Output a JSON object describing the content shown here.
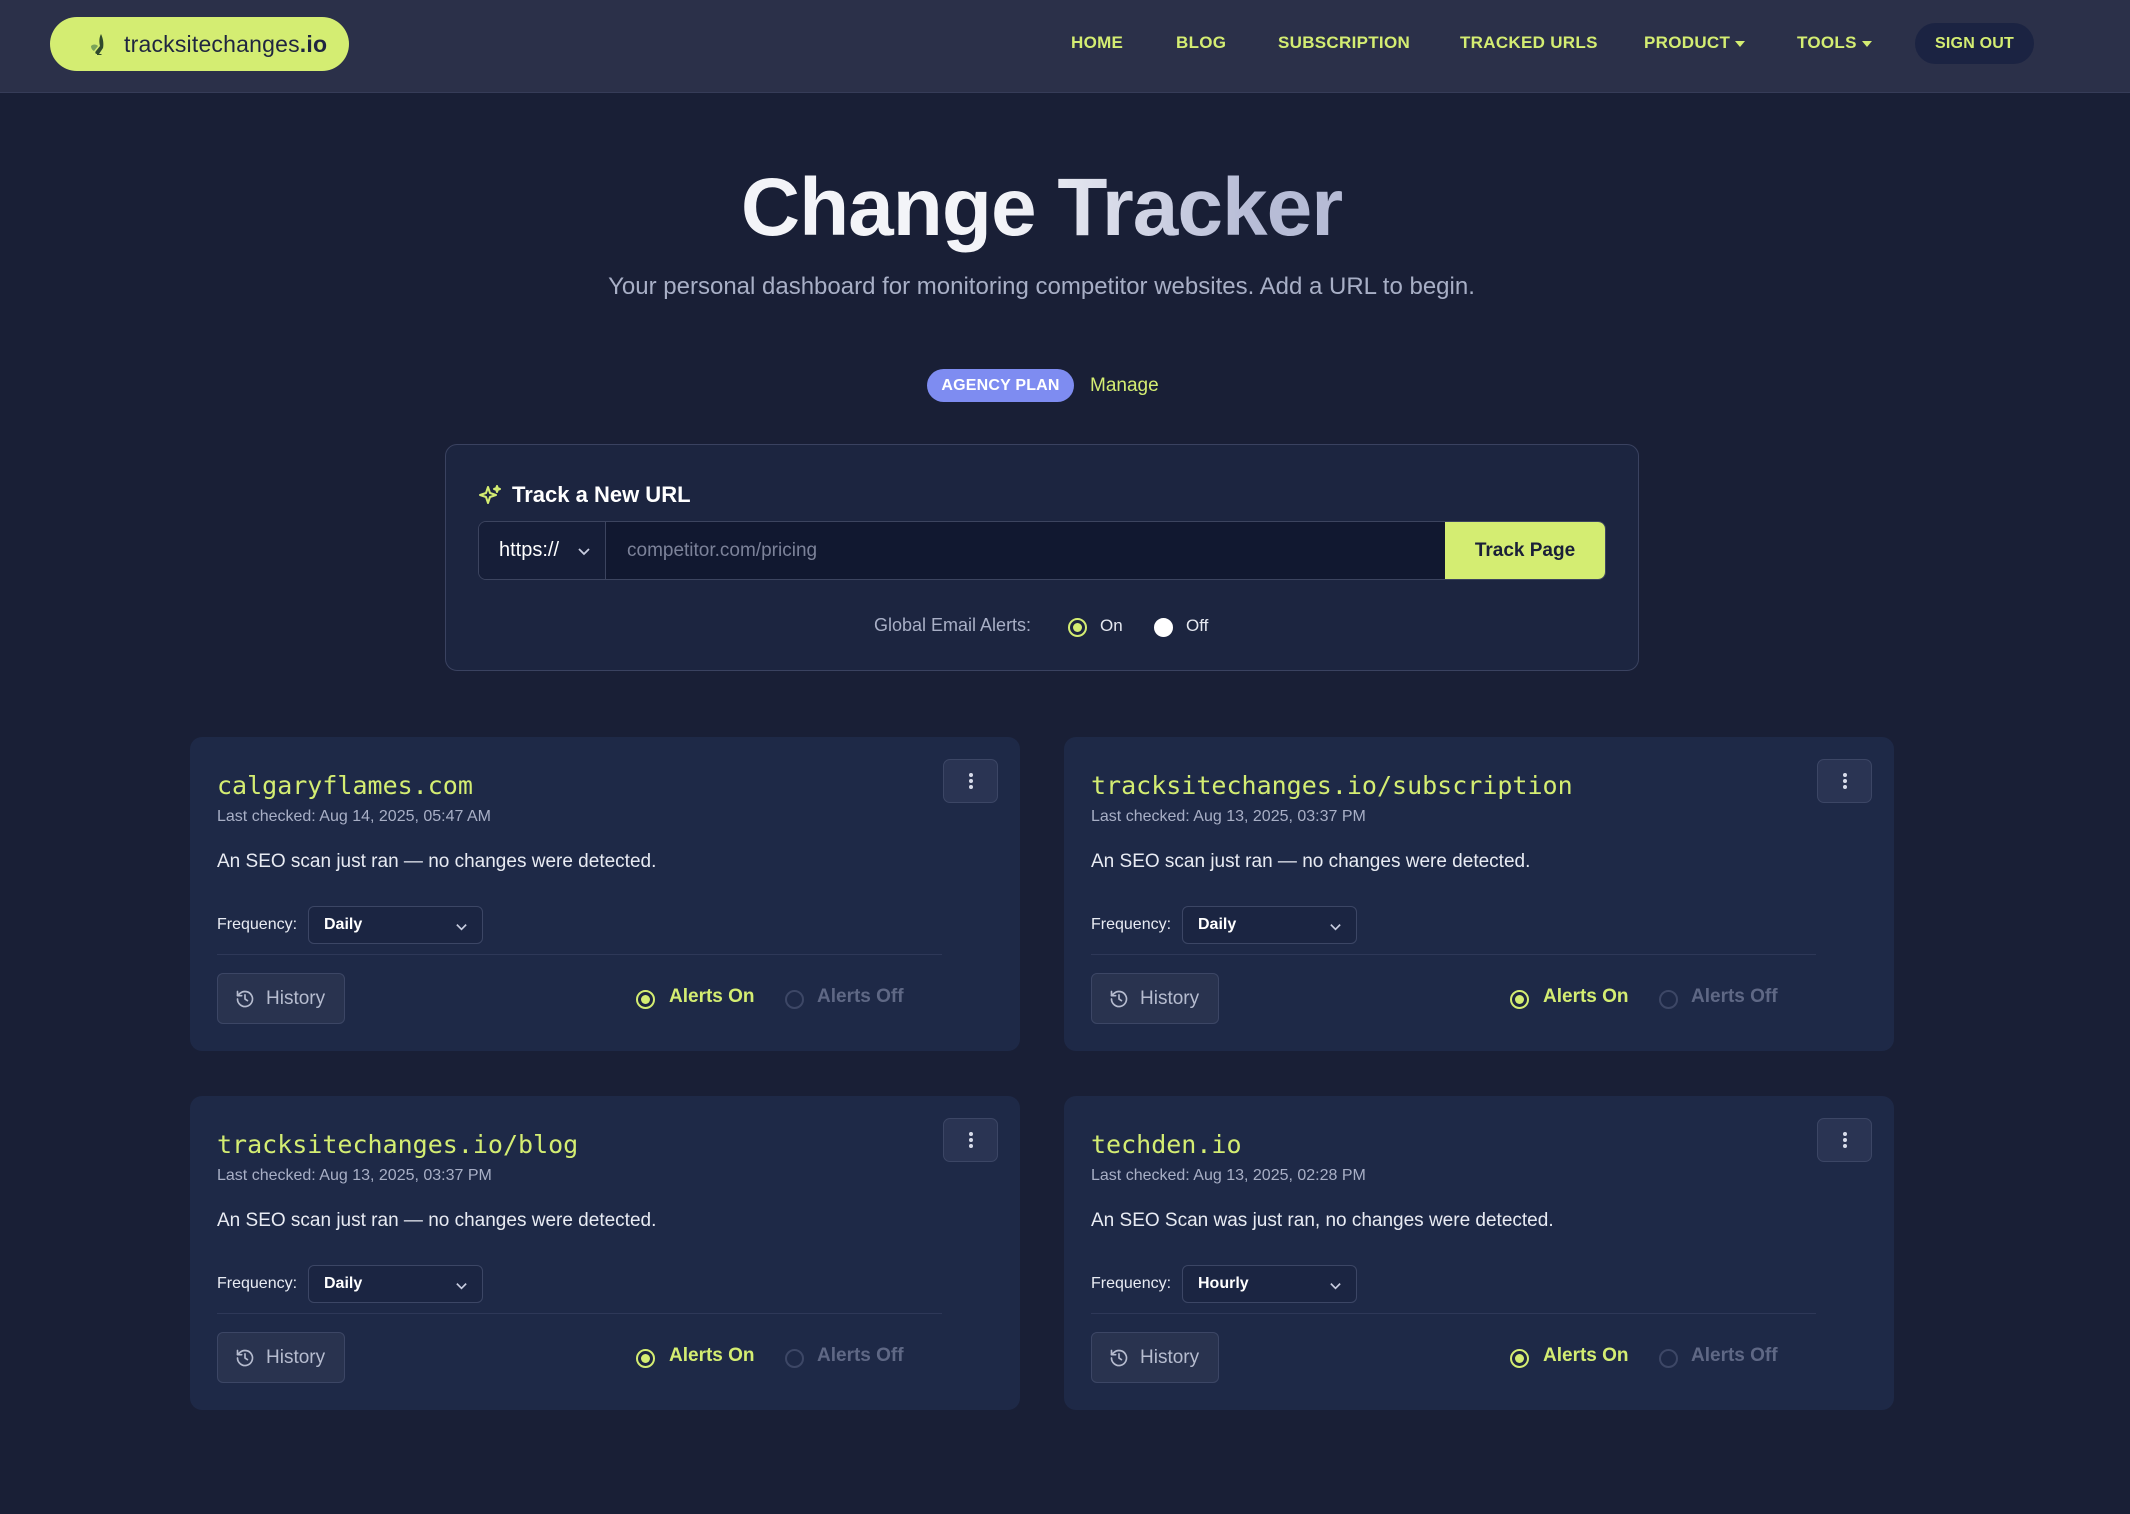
{
  "brand": {
    "name_prefix": "tracksitechanges",
    "name_suffix": ".io",
    "icon": "bird-icon"
  },
  "nav": {
    "home": "HOME",
    "blog": "BLOG",
    "subscription": "SUBSCRIPTION",
    "tracked_urls": "TRACKED URLS",
    "product": "PRODUCT",
    "tools": "TOOLS",
    "sign_out": "SIGN OUT"
  },
  "hero": {
    "title": "Change Tracker",
    "subtitle": "Your personal dashboard for monitoring competitor websites. Add a URL to begin."
  },
  "plan": {
    "badge": "AGENCY PLAN",
    "manage": "Manage"
  },
  "track": {
    "heading": "Track a New URL",
    "protocol": "https://",
    "placeholder": "competitor.com/pricing",
    "button": "Track Page",
    "global_alerts_label": "Global Email Alerts:",
    "on_label": "On",
    "off_label": "Off",
    "global_alerts_value": "On"
  },
  "cards": [
    {
      "url": "calgaryflames.com",
      "last_checked": "Last checked: Aug 14, 2025, 05:47 AM",
      "status": "An SEO scan just ran — no changes were detected.",
      "frequency_label": "Frequency:",
      "frequency": "Daily",
      "history": "History",
      "alerts_on": "Alerts On",
      "alerts_off": "Alerts Off"
    },
    {
      "url": "tracksitechanges.io/subscription",
      "last_checked": "Last checked: Aug 13, 2025, 03:37 PM",
      "status": "An SEO scan just ran — no changes were detected.",
      "frequency_label": "Frequency:",
      "frequency": "Daily",
      "history": "History",
      "alerts_on": "Alerts On",
      "alerts_off": "Alerts Off"
    },
    {
      "url": "tracksitechanges.io/blog",
      "last_checked": "Last checked: Aug 13, 2025, 03:37 PM",
      "status": "An SEO scan just ran — no changes were detected.",
      "frequency_label": "Frequency:",
      "frequency": "Daily",
      "history": "History",
      "alerts_on": "Alerts On",
      "alerts_off": "Alerts Off"
    },
    {
      "url": "techden.io",
      "last_checked": "Last checked: Aug 13, 2025, 02:28 PM",
      "status": "An SEO Scan was just ran, no changes were detected.",
      "frequency_label": "Frequency:",
      "frequency": "Hourly",
      "history": "History",
      "alerts_on": "Alerts On",
      "alerts_off": "Alerts Off"
    }
  ],
  "colors": {
    "background": "#191f36",
    "navbar": "#2b3049",
    "accent": "#d4ed72",
    "card": "#1e2947",
    "plan_badge": "#7e8cf1"
  }
}
